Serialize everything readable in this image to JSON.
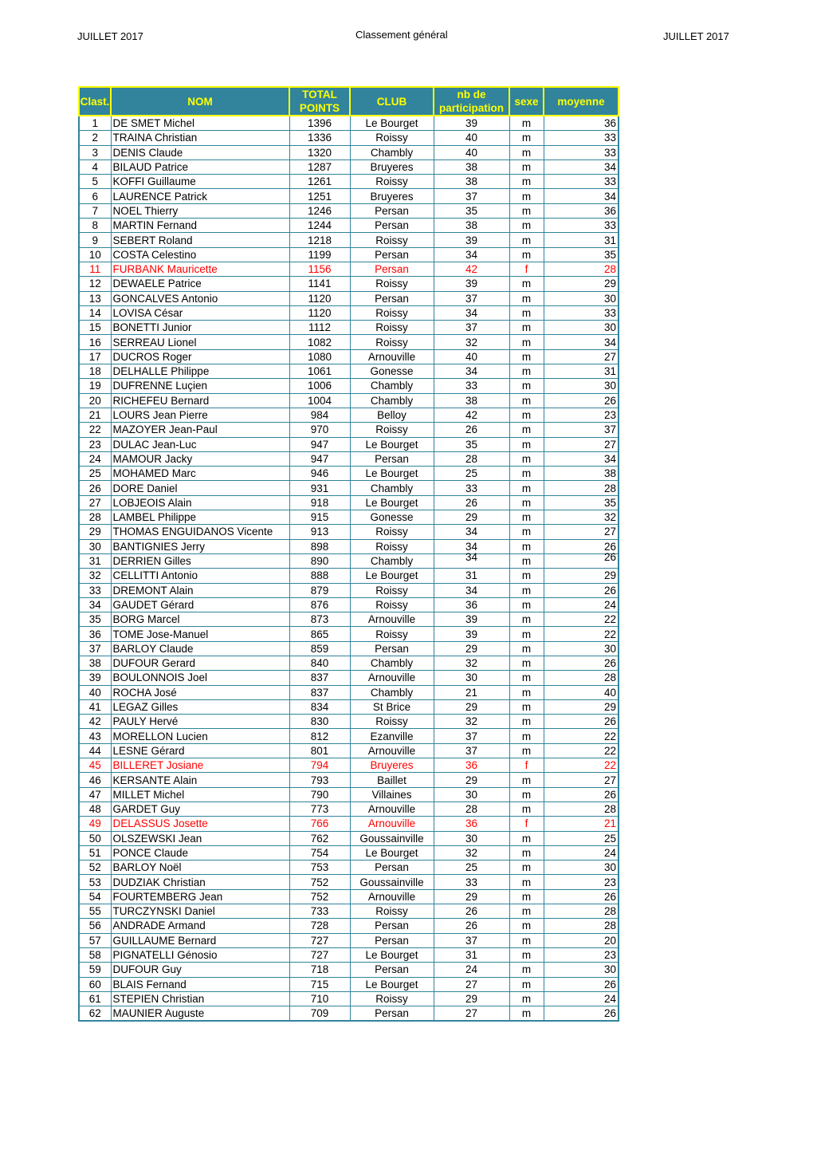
{
  "page_header": {
    "left": "JUILLET 2017",
    "center": "Classement général",
    "right": "JUILLET 2017"
  },
  "colors": {
    "header_bg": "#31849b",
    "header_text": "#ffff00",
    "female_text": "#ff0000"
  },
  "table": {
    "headers": {
      "rank": "Clast.",
      "name": "NOM",
      "points_l1": "TOTAL",
      "points_l2": "POINTS",
      "club": "CLUB",
      "participation_l1": "nb de",
      "participation_l2": "participation",
      "sex": "sexe",
      "average": "moyenne"
    },
    "rows": [
      {
        "rank": "1",
        "name": "DE SMET Michel",
        "points": "1396",
        "club": "Le Bourget",
        "participation": "39",
        "sex": "m",
        "average": "36"
      },
      {
        "rank": "2",
        "name": "TRAINA Christian",
        "points": "1336",
        "club": "Roissy",
        "participation": "40",
        "sex": "m",
        "average": "33"
      },
      {
        "rank": "3",
        "name": "DENIS Claude",
        "points": "1320",
        "club": "Chambly",
        "participation": "40",
        "sex": "m",
        "average": "33"
      },
      {
        "rank": "4",
        "name": "BILAUD Patrice",
        "points": "1287",
        "club": "Bruyeres",
        "participation": "38",
        "sex": "m",
        "average": "34"
      },
      {
        "rank": "5",
        "name": "KOFFI Guillaume",
        "points": "1261",
        "club": "Roissy",
        "participation": "38",
        "sex": "m",
        "average": "33"
      },
      {
        "rank": "6",
        "name": "LAURENCE Patrick",
        "points": "1251",
        "club": "Bruyeres",
        "participation": "37",
        "sex": "m",
        "average": "34"
      },
      {
        "rank": "7",
        "name": "NOEL Thierry",
        "points": "1246",
        "club": "Persan",
        "participation": "35",
        "sex": "m",
        "average": "36"
      },
      {
        "rank": "8",
        "name": "MARTIN Fernand",
        "points": "1244",
        "club": "Persan",
        "participation": "38",
        "sex": "m",
        "average": "33"
      },
      {
        "rank": "9",
        "name": "SEBERT Roland",
        "points": "1218",
        "club": "Roissy",
        "participation": "39",
        "sex": "m",
        "average": "31"
      },
      {
        "rank": "10",
        "name": "COSTA Celestino",
        "points": "1199",
        "club": "Persan",
        "participation": "34",
        "sex": "m",
        "average": "35"
      },
      {
        "rank": "11",
        "name": "FURBANK Mauricette",
        "points": "1156",
        "club": "Persan",
        "participation": "42",
        "sex": "f",
        "average": "28"
      },
      {
        "rank": "12",
        "name": "DEWAELE Patrice",
        "points": "1141",
        "club": "Roissy",
        "participation": "39",
        "sex": "m",
        "average": "29"
      },
      {
        "rank": "13",
        "name": "GONCALVES Antonio",
        "points": "1120",
        "club": "Persan",
        "participation": "37",
        "sex": "m",
        "average": "30"
      },
      {
        "rank": "14",
        "name": "LOVISA César",
        "points": "1120",
        "club": "Roissy",
        "participation": "34",
        "sex": "m",
        "average": "33"
      },
      {
        "rank": "15",
        "name": "BONETTI Junior",
        "points": "1112",
        "club": "Roissy",
        "participation": "37",
        "sex": "m",
        "average": "30"
      },
      {
        "rank": "16",
        "name": "SERREAU Lionel",
        "points": "1082",
        "club": "Roissy",
        "participation": "32",
        "sex": "m",
        "average": "34"
      },
      {
        "rank": "17",
        "name": "DUCROS Roger",
        "points": "1080",
        "club": "Arnouville",
        "participation": "40",
        "sex": "m",
        "average": "27"
      },
      {
        "rank": "18",
        "name": "DELHALLE Philippe",
        "points": "1061",
        "club": "Gonesse",
        "participation": "34",
        "sex": "m",
        "average": "31"
      },
      {
        "rank": "19",
        "name": "DUFRENNE Luçien",
        "points": "1006",
        "club": "Chambly",
        "participation": "33",
        "sex": "m",
        "average": "30"
      },
      {
        "rank": "20",
        "name": "RICHEFEU Bernard",
        "points": "1004",
        "club": "Chambly",
        "participation": "38",
        "sex": "m",
        "average": "26"
      },
      {
        "rank": "21",
        "name": "LOURS Jean Pierre",
        "points": "984",
        "club": "Belloy",
        "participation": "42",
        "sex": "m",
        "average": "23"
      },
      {
        "rank": "22",
        "name": "MAZOYER Jean-Paul",
        "points": "970",
        "club": "Roissy",
        "participation": "26",
        "sex": "m",
        "average": "37"
      },
      {
        "rank": "23",
        "name": "DULAC Jean-Luc",
        "points": "947",
        "club": "Le Bourget",
        "participation": "35",
        "sex": "m",
        "average": "27"
      },
      {
        "rank": "24",
        "name": "MAMOUR Jacky",
        "points": "947",
        "club": "Persan",
        "participation": "28",
        "sex": "m",
        "average": "34"
      },
      {
        "rank": "25",
        "name": "MOHAMED Marc",
        "points": "946",
        "club": "Le Bourget",
        "participation": "25",
        "sex": "m",
        "average": "38"
      },
      {
        "rank": "26",
        "name": "DORE Daniel",
        "points": "931",
        "club": "Chambly",
        "participation": "33",
        "sex": "m",
        "average": "28"
      },
      {
        "rank": "27",
        "name": "LOBJEOIS Alain",
        "points": "918",
        "club": "Le Bourget",
        "participation": "26",
        "sex": "m",
        "average": "35"
      },
      {
        "rank": "28",
        "name": "LAMBEL Philippe",
        "points": "915",
        "club": "Gonesse",
        "participation": "29",
        "sex": "m",
        "average": "32"
      },
      {
        "rank": "29",
        "name": "THOMAS ENGUIDANOS Vicente",
        "points": "913",
        "club": "Roissy",
        "participation": "34",
        "sex": "m",
        "average": "27"
      },
      {
        "rank": "30",
        "name": "BANTIGNIES Jerry",
        "points": "898",
        "club": "Roissy",
        "participation": "34",
        "sex": "m",
        "average": "26"
      },
      {
        "rank": "31",
        "name": "DERRIEN Gilles",
        "points": "890",
        "club": "Chambly",
        "participation": "34",
        "sex": "m",
        "average": "26"
      },
      {
        "rank": "32",
        "name": "CELLITTI Antonio",
        "points": "888",
        "club": "Le Bourget",
        "participation": "31",
        "sex": "m",
        "average": "29"
      },
      {
        "rank": "33",
        "name": "DREMONT Alain",
        "points": "879",
        "club": "Roissy",
        "participation": "34",
        "sex": "m",
        "average": "26"
      },
      {
        "rank": "34",
        "name": "GAUDET Gérard",
        "points": "876",
        "club": "Roissy",
        "participation": "36",
        "sex": "m",
        "average": "24"
      },
      {
        "rank": "35",
        "name": "BORG Marcel",
        "points": "873",
        "club": "Arnouville",
        "participation": "39",
        "sex": "m",
        "average": "22"
      },
      {
        "rank": "36",
        "name": "TOME Jose-Manuel",
        "points": "865",
        "club": "Roissy",
        "participation": "39",
        "sex": "m",
        "average": "22"
      },
      {
        "rank": "37",
        "name": "BARLOY Claude",
        "points": "859",
        "club": "Persan",
        "participation": "29",
        "sex": "m",
        "average": "30"
      },
      {
        "rank": "38",
        "name": "DUFOUR Gerard",
        "points": "840",
        "club": "Chambly",
        "participation": "32",
        "sex": "m",
        "average": "26"
      },
      {
        "rank": "39",
        "name": "BOULONNOIS Joel",
        "points": "837",
        "club": "Arnouville",
        "participation": "30",
        "sex": "m",
        "average": "28"
      },
      {
        "rank": "40",
        "name": "ROCHA José",
        "points": "837",
        "club": "Chambly",
        "participation": "21",
        "sex": "m",
        "average": "40"
      },
      {
        "rank": "41",
        "name": "LEGAZ Gilles",
        "points": "834",
        "club": "St Brice",
        "participation": "29",
        "sex": "m",
        "average": "29"
      },
      {
        "rank": "42",
        "name": "PAULY Hervé",
        "points": "830",
        "club": "Roissy",
        "participation": "32",
        "sex": "m",
        "average": "26"
      },
      {
        "rank": "43",
        "name": "MORELLON Lucien",
        "points": "812",
        "club": "Ezanville",
        "participation": "37",
        "sex": "m",
        "average": "22"
      },
      {
        "rank": "44",
        "name": "LESNE Gérard",
        "points": "801",
        "club": "Arnouville",
        "participation": "37",
        "sex": "m",
        "average": "22"
      },
      {
        "rank": "45",
        "name": "BILLERET Josiane",
        "points": "794",
        "club": "Bruyeres",
        "participation": "36",
        "sex": "f",
        "average": "22"
      },
      {
        "rank": "46",
        "name": "KERSANTE Alain",
        "points": "793",
        "club": "Baillet",
        "participation": "29",
        "sex": "m",
        "average": "27"
      },
      {
        "rank": "47",
        "name": "MILLET Michel",
        "points": "790",
        "club": "Villaines",
        "participation": "30",
        "sex": "m",
        "average": "26"
      },
      {
        "rank": "48",
        "name": "GARDET Guy",
        "points": "773",
        "club": "Arnouville",
        "participation": "28",
        "sex": "m",
        "average": "28"
      },
      {
        "rank": "49",
        "name": "DELASSUS Josette",
        "points": "766",
        "club": "Arnouville",
        "participation": "36",
        "sex": "f",
        "average": "21"
      },
      {
        "rank": "50",
        "name": "OLSZEWSKI Jean",
        "points": "762",
        "club": "Goussainville",
        "participation": "30",
        "sex": "m",
        "average": "25"
      },
      {
        "rank": "51",
        "name": "PONCE Claude",
        "points": "754",
        "club": "Le Bourget",
        "participation": "32",
        "sex": "m",
        "average": "24"
      },
      {
        "rank": "52",
        "name": "BARLOY Noël",
        "points": "753",
        "club": "Persan",
        "participation": "25",
        "sex": "m",
        "average": "30"
      },
      {
        "rank": "53",
        "name": "DUDZIAK Christian",
        "points": "752",
        "club": "Goussainville",
        "participation": "33",
        "sex": "m",
        "average": "23"
      },
      {
        "rank": "54",
        "name": "FOURTEMBERG Jean",
        "points": "752",
        "club": "Arnouville",
        "participation": "29",
        "sex": "m",
        "average": "26"
      },
      {
        "rank": "55",
        "name": "TURCZYNSKI Daniel",
        "points": "733",
        "club": "Roissy",
        "participation": "26",
        "sex": "m",
        "average": "28"
      },
      {
        "rank": "56",
        "name": "ANDRADE Armand",
        "points": "728",
        "club": "Persan",
        "participation": "26",
        "sex": "m",
        "average": "28"
      },
      {
        "rank": "57",
        "name": "GUILLAUME Bernard",
        "points": "727",
        "club": "Persan",
        "participation": "37",
        "sex": "m",
        "average": "20"
      },
      {
        "rank": "58",
        "name": "PIGNATELLI Génosio",
        "points": "727",
        "club": "Le Bourget",
        "participation": "31",
        "sex": "m",
        "average": "23"
      },
      {
        "rank": "59",
        "name": "DUFOUR Guy",
        "points": "718",
        "club": "Persan",
        "participation": "24",
        "sex": "m",
        "average": "30"
      },
      {
        "rank": "60",
        "name": "BLAIS Fernand",
        "points": "715",
        "club": "Le Bourget",
        "participation": "27",
        "sex": "m",
        "average": "26"
      },
      {
        "rank": "61",
        "name": "STEPIEN Christian",
        "points": "710",
        "club": "Roissy",
        "participation": "29",
        "sex": "m",
        "average": "24"
      },
      {
        "rank": "62",
        "name": "MAUNIER Auguste",
        "points": "709",
        "club": "Persan",
        "participation": "27",
        "sex": "m",
        "average": "26"
      }
    ]
  }
}
